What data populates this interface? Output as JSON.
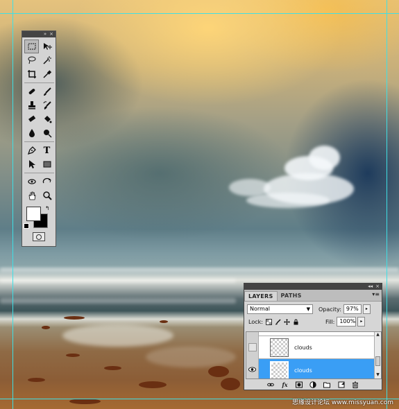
{
  "tools_panel": {
    "title_glyphs": [
      "»",
      "×"
    ],
    "tools": [
      [
        "rect-marquee-icon",
        "move-icon"
      ],
      [
        "lasso-icon",
        "magic-wand-icon"
      ],
      [
        "crop-icon",
        "eyedropper-icon"
      ],
      [
        "healing-brush-icon",
        "brush-icon"
      ],
      [
        "clone-stamp-icon",
        "history-brush-icon"
      ],
      [
        "eraser-icon",
        "paint-bucket-icon"
      ],
      [
        "blur-icon",
        "dodge-icon"
      ],
      [
        "pen-icon",
        "type-icon"
      ],
      [
        "path-select-icon",
        "rectangle-shape-icon"
      ],
      [
        "3d-rotate-icon",
        "3d-orbit-icon"
      ],
      [
        "hand-icon",
        "zoom-icon"
      ]
    ],
    "foreground_color": "#ffffff",
    "background_color": "#000000",
    "swap_glyph": "↰",
    "type_tool_glyph": "T"
  },
  "layers_panel": {
    "title_glyphs": [
      "◂◂",
      "×"
    ],
    "tabs": [
      "LAYERS",
      "PATHS"
    ],
    "menu_glyph": "▾≡",
    "blend_mode": "Normal",
    "opacity_label": "Opacity:",
    "opacity_value": "97%",
    "lock_label": "Lock:",
    "fill_label": "Fill:",
    "fill_value": "100%",
    "spin_glyph": "▸",
    "layers": [
      {
        "name": "clouds",
        "visible": false,
        "selected": false
      },
      {
        "name": "clouds",
        "visible": true,
        "selected": true
      }
    ],
    "footer_icons": [
      "link-icon",
      "fx-icon",
      "mask-icon",
      "adjustment-icon",
      "group-icon",
      "new-layer-icon",
      "trash-icon"
    ],
    "fx_label": "fx"
  },
  "watermark": "思缘设计论坛 www.missyuan.com",
  "guide_color": "#3ee0e6",
  "selection_color": "#3a9ef5"
}
